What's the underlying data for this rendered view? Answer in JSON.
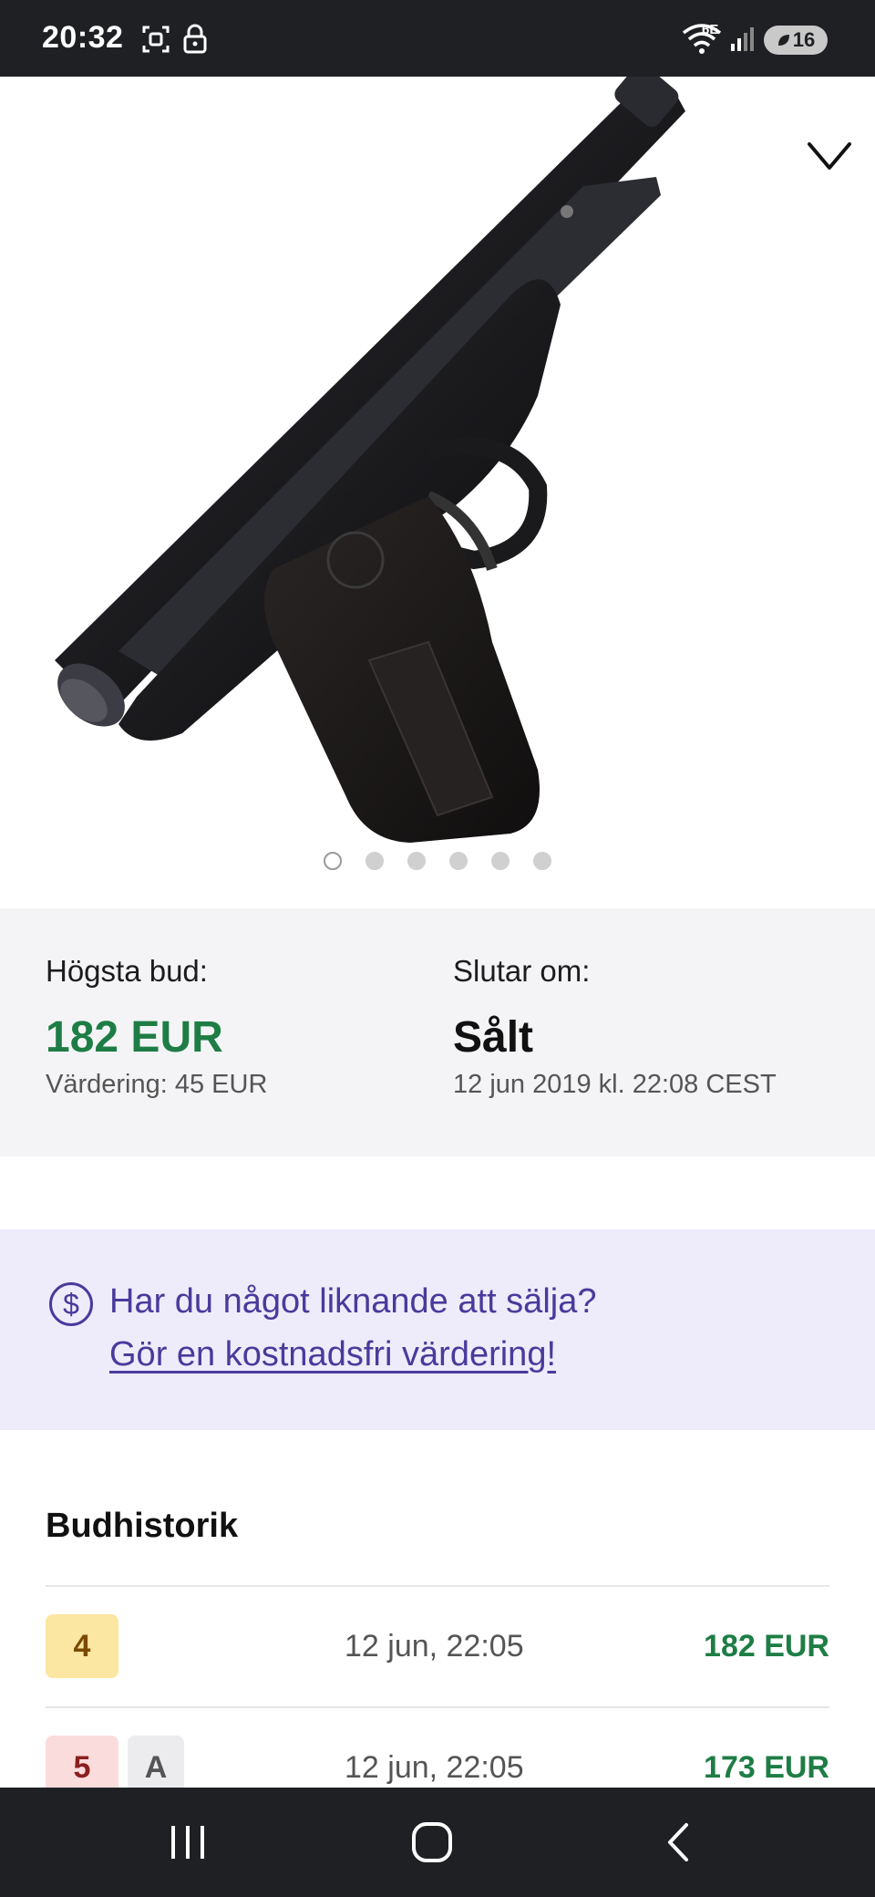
{
  "status_bar": {
    "time": "20:32",
    "network": "6E",
    "battery": "16",
    "icons": [
      "screenshot-icon",
      "lock-icon",
      "wifi-icon",
      "signal-icon",
      "battery-icon"
    ]
  },
  "gallery": {
    "image_count": 6,
    "active_index": 0,
    "favorite_icon": "heart-icon"
  },
  "bid_summary": {
    "highest_bid_label": "Högsta bud:",
    "highest_bid_value": "182 EUR",
    "valuation": "Värdering: 45 EUR",
    "ends_label": "Slutar om:",
    "ends_value": "Sålt",
    "ends_date": "12 jun 2019 kl. 22:08 CEST"
  },
  "sell_banner": {
    "question": "Har du något liknande att sälja?",
    "link": "Gör en kostnadsfri värdering!",
    "icon": "dollar-icon"
  },
  "bid_history": {
    "title": "Budhistorik",
    "rows": [
      {
        "bidder": "4",
        "auto": "",
        "time": "12 jun, 22:05",
        "amount": "182 EUR"
      },
      {
        "bidder": "5",
        "auto": "A",
        "time": "12 jun, 22:05",
        "amount": "173 EUR"
      }
    ]
  },
  "nav": {
    "icons": [
      "recents-icon",
      "home-icon",
      "back-icon"
    ]
  },
  "colors": {
    "price_green": "#1e7d45",
    "banner_purple": "#4a3a9c",
    "banner_bg": "#eeecfa",
    "summary_bg": "#f4f4f6"
  }
}
